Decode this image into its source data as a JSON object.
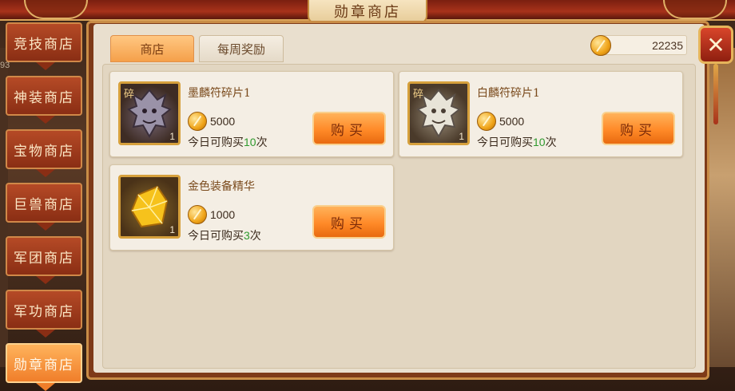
{
  "header": {
    "title": "勋章商店"
  },
  "currency": {
    "amount": "22235",
    "icon": "medal-coin-icon"
  },
  "tabs": [
    {
      "label": "商店",
      "active": true
    },
    {
      "label": "每周奖励",
      "active": false
    }
  ],
  "sidebar": {
    "tag": "93",
    "items": [
      {
        "label": "竞技商店",
        "active": false
      },
      {
        "label": "神装商店",
        "active": false
      },
      {
        "label": "宝物商店",
        "active": false
      },
      {
        "label": "巨兽商店",
        "active": false
      },
      {
        "label": "军团商店",
        "active": false
      },
      {
        "label": "军功商店",
        "active": false
      },
      {
        "label": "勋章商店",
        "active": true
      }
    ]
  },
  "items": [
    {
      "name": "墨麟符碎片1",
      "fragment_tag": "碎",
      "count": "1",
      "price": "5000",
      "limit_prefix": "今日可购买",
      "limit_num": "10",
      "limit_suffix": "次",
      "buy_label": "购买",
      "icon": "dark-beast-head-icon"
    },
    {
      "name": "白麟符碎片1",
      "fragment_tag": "碎",
      "count": "1",
      "price": "5000",
      "limit_prefix": "今日可购买",
      "limit_num": "10",
      "limit_suffix": "次",
      "buy_label": "购买",
      "icon": "white-beast-head-icon"
    },
    {
      "name": "金色装备精华",
      "fragment_tag": "",
      "count": "1",
      "price": "1000",
      "limit_prefix": "今日可购买",
      "limit_num": "3",
      "limit_suffix": "次",
      "buy_label": "购买",
      "icon": "gold-crystal-icon"
    }
  ],
  "colors": {
    "accent": "#f5a04a",
    "panel": "#e9dfce",
    "frame": "#7e3a18",
    "limit_number": "#2f9a2f"
  }
}
